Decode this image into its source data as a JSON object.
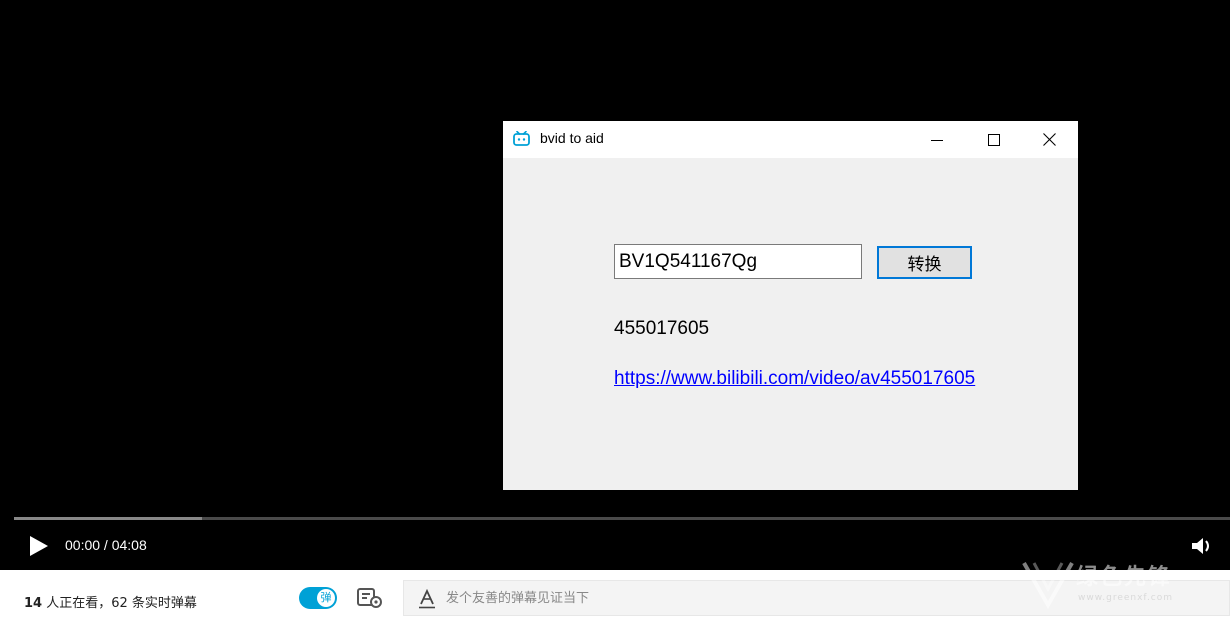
{
  "window": {
    "title": "bvid to aid",
    "app_icon": "bilibili-tv-icon",
    "controls": {
      "minimize_icon": "minimize-icon",
      "maximize_icon": "maximize-icon",
      "close_icon": "close-icon"
    }
  },
  "form": {
    "bvid_value": "BV1Q541167Qg",
    "convert_label": "转换",
    "aid_result": "455017605",
    "video_link": "https://www.bilibili.com/video/av455017605"
  },
  "player": {
    "current_time": "00:00",
    "separator": " / ",
    "duration": "04:08",
    "progress_fraction": 0.155,
    "play_icon": "play-icon",
    "volume_icon": "volume-icon",
    "accent_color": "#00a1d6"
  },
  "bottom_bar": {
    "viewer_count": "14",
    "viewers_label": " 人正在看，",
    "danmaku_count": "62",
    "danmaku_label": " 条实时弹幕",
    "toggle_label": "弹",
    "toggle_on": true,
    "danmaku_placeholder": "发个友善的弹幕见证当下",
    "font_icon": "font-style-icon",
    "settings_icon": "danmaku-settings-icon"
  },
  "watermark": {
    "text": "绿色先锋",
    "url": "www.greenxf.com"
  }
}
